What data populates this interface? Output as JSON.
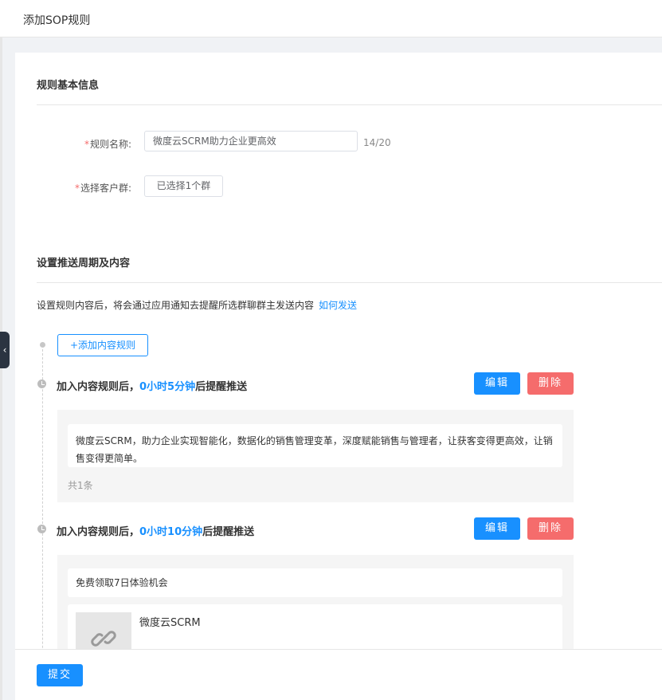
{
  "header": {
    "title": "添加SOP规则"
  },
  "basic": {
    "title": "规则基本信息",
    "name_label": "规则名称:",
    "name_value": "微度云SCRM助力企业更高效",
    "name_counter": "14/20",
    "group_label": "选择客户群:",
    "group_button": "已选择1个群",
    "required_mark": "*"
  },
  "push": {
    "title": "设置推送周期及内容",
    "desc": "设置规则内容后，将会通过应用通知去提醒所选群聊群主发送内容",
    "how_link": "如何发送",
    "add_button": "+添加内容规则"
  },
  "rules": [
    {
      "prefix": "加入内容规则后，",
      "time": "0小时5分钟",
      "suffix": "后提醒推送",
      "edit": "编辑",
      "delete": "删除",
      "message": "微度云SCRM，助力企业实现智能化，数据化的销售管理变革，深度赋能销售与管理者，让获客变得更高效，让销售变得更简单。",
      "total": "共1条"
    },
    {
      "prefix": "加入内容规则后，",
      "time": "0小时10分钟",
      "suffix": "后提醒推送",
      "edit": "编辑",
      "delete": "删除",
      "message": "免费领取7日体验机会",
      "link_title": "微度云SCRM"
    }
  ],
  "footer": {
    "submit": "提交"
  },
  "colors": {
    "primary": "#1890ff",
    "danger": "#f56c6c",
    "required": "#f56c6c"
  }
}
